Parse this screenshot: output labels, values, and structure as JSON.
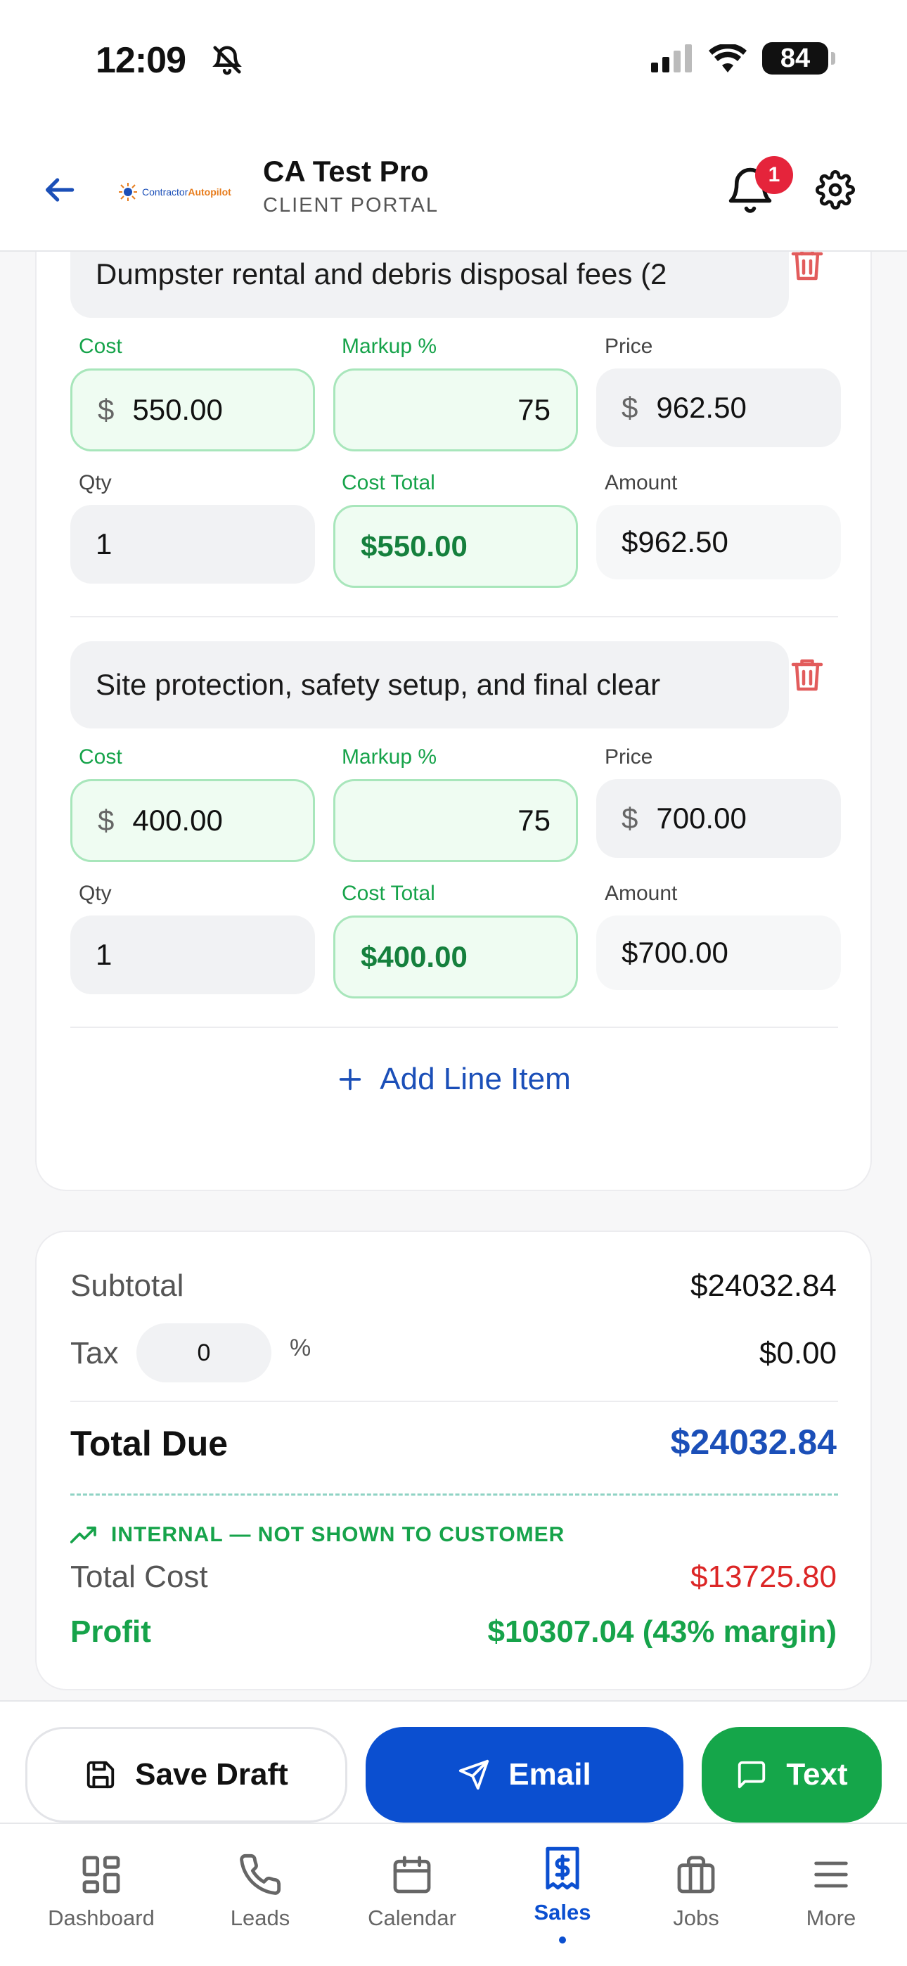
{
  "status_bar": {
    "time": "12:09",
    "battery": "84"
  },
  "header": {
    "title": "CA Test Pro",
    "subtitle": "CLIENT PORTAL",
    "logo_text_a": "Contractor",
    "logo_text_b": "Autopilot",
    "notification_count": "1"
  },
  "line_items": [
    {
      "description": "Dumpster rental and debris disposal fees (2",
      "cost_label": "Cost",
      "cost_currency": "$",
      "cost": "550.00",
      "markup_label": "Markup %",
      "markup": "75",
      "price_label": "Price",
      "price_currency": "$",
      "price": "962.50",
      "qty_label": "Qty",
      "qty": "1",
      "cost_total_label": "Cost Total",
      "cost_total": "$550.00",
      "amount_label": "Amount",
      "amount": "$962.50"
    },
    {
      "description": "Site protection, safety setup, and final clear",
      "cost_label": "Cost",
      "cost_currency": "$",
      "cost": "400.00",
      "markup_label": "Markup %",
      "markup": "75",
      "price_label": "Price",
      "price_currency": "$",
      "price": "700.00",
      "qty_label": "Qty",
      "qty": "1",
      "cost_total_label": "Cost Total",
      "cost_total": "$400.00",
      "amount_label": "Amount",
      "amount": "$700.00"
    }
  ],
  "add_line_item": "Add Line Item",
  "totals": {
    "subtotal_label": "Subtotal",
    "subtotal": "$24032.84",
    "tax_label": "Tax",
    "tax_rate": "0",
    "tax_pct": "%",
    "tax_amount": "$0.00",
    "total_due_label": "Total Due",
    "total_due": "$24032.84",
    "internal_label": "INTERNAL — NOT SHOWN TO CUSTOMER",
    "total_cost_label": "Total Cost",
    "total_cost": "$13725.80",
    "profit_label": "Profit",
    "profit": "$10307.04 (43% margin)"
  },
  "actions": {
    "save_draft": "Save Draft",
    "email": "Email",
    "text": "Text"
  },
  "nav": [
    {
      "label": "Dashboard",
      "icon": "dashboard-icon"
    },
    {
      "label": "Leads",
      "icon": "phone-icon"
    },
    {
      "label": "Calendar",
      "icon": "calendar-icon"
    },
    {
      "label": "Sales",
      "icon": "receipt-dollar-icon",
      "active": true
    },
    {
      "label": "Jobs",
      "icon": "briefcase-icon"
    },
    {
      "label": "More",
      "icon": "menu-icon"
    }
  ],
  "colors": {
    "accent": "#0b4fd0",
    "success": "#15a64a",
    "danger": "#dc2626"
  }
}
